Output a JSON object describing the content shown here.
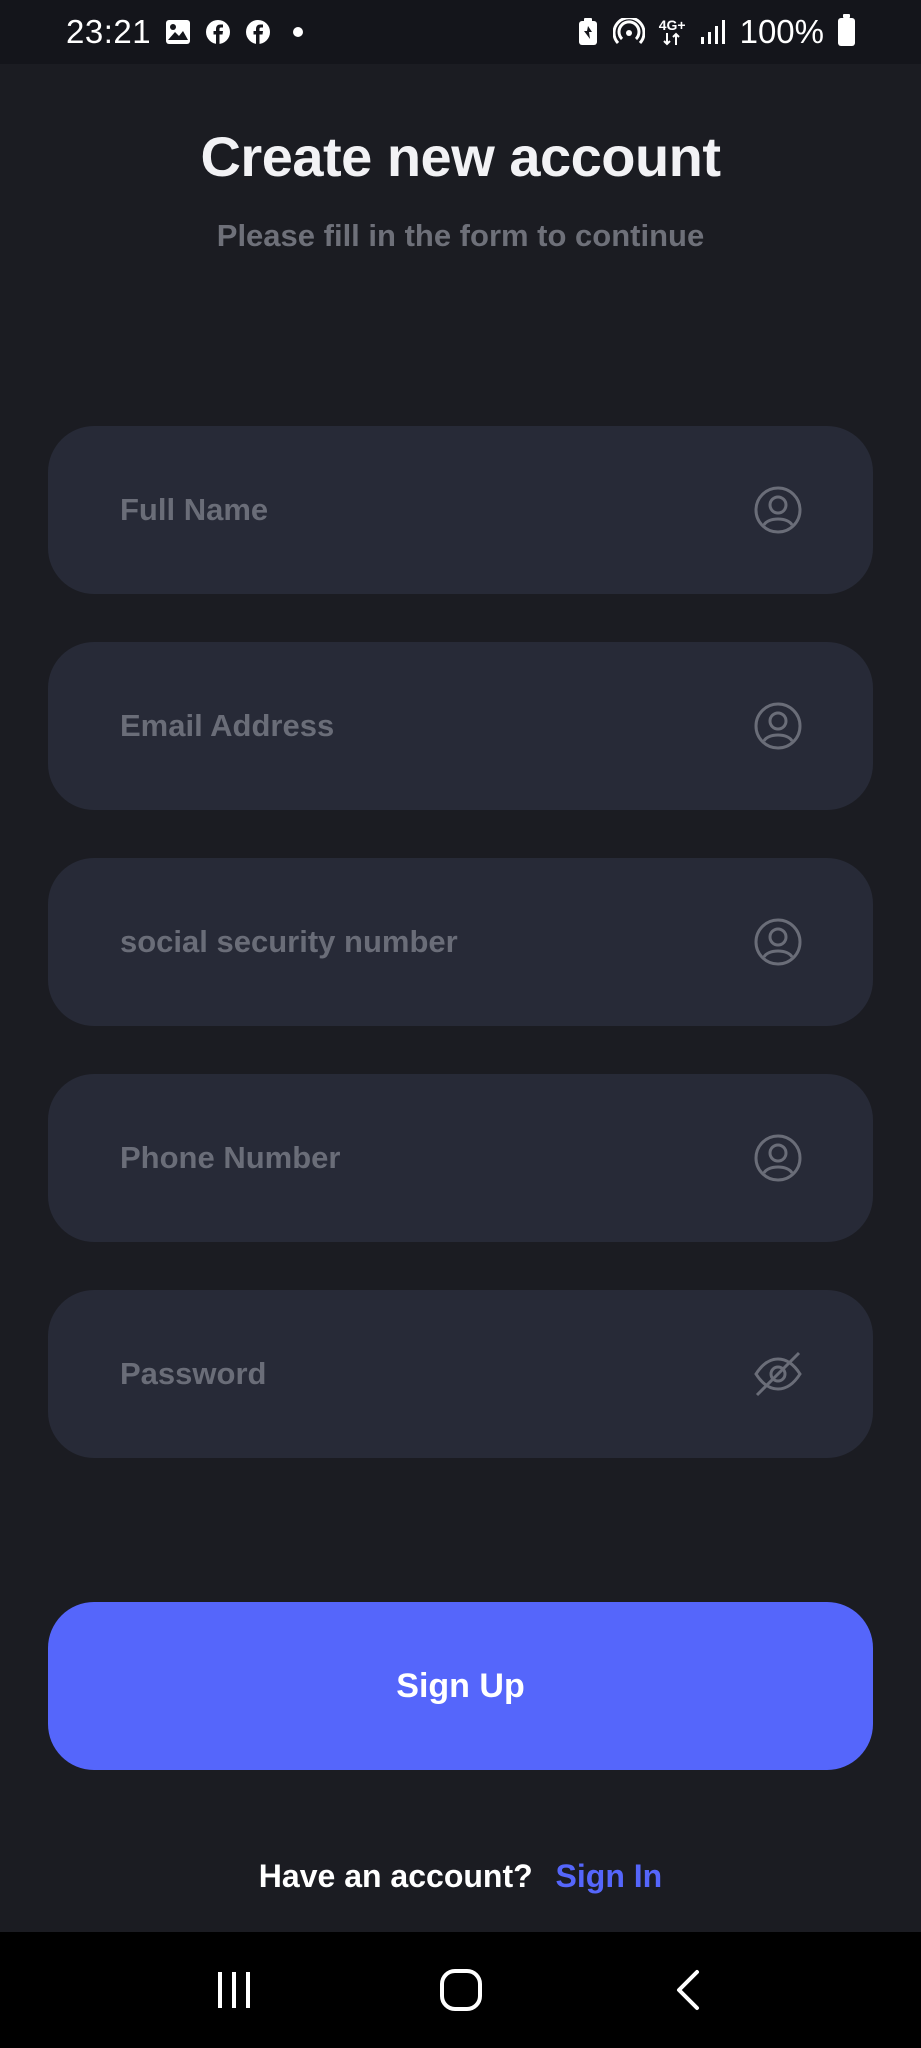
{
  "status_bar": {
    "time": "23:21",
    "network": "4G+",
    "battery": "100%",
    "icons": [
      "gallery-icon",
      "facebook-icon",
      "facebook-icon",
      "notification-dot",
      "battery-saver-icon",
      "hotspot-icon",
      "network-4g-icon",
      "signal-icon",
      "battery-icon"
    ]
  },
  "header": {
    "title": "Create new account",
    "subtitle": "Please fill in the form to continue"
  },
  "form": {
    "fields": [
      {
        "placeholder": "Full Name",
        "value": "",
        "icon": "user-icon"
      },
      {
        "placeholder": "Email Address",
        "value": "",
        "icon": "user-icon"
      },
      {
        "placeholder": "social security number",
        "value": "",
        "icon": "user-icon"
      },
      {
        "placeholder": "Phone Number",
        "value": "",
        "icon": "user-icon"
      },
      {
        "placeholder": "Password",
        "value": "",
        "icon": "eye-off-icon"
      }
    ],
    "submit_label": "Sign Up"
  },
  "footer": {
    "prompt": "Have an account?",
    "link_label": "Sign In"
  },
  "nav": {
    "icons": [
      "recent-apps-icon",
      "home-icon",
      "back-icon"
    ]
  },
  "colors": {
    "background": "#1b1c22",
    "field_background": "#272a37",
    "accent": "#5566fb",
    "placeholder": "#6a6d78",
    "subtitle": "#6e7079"
  }
}
